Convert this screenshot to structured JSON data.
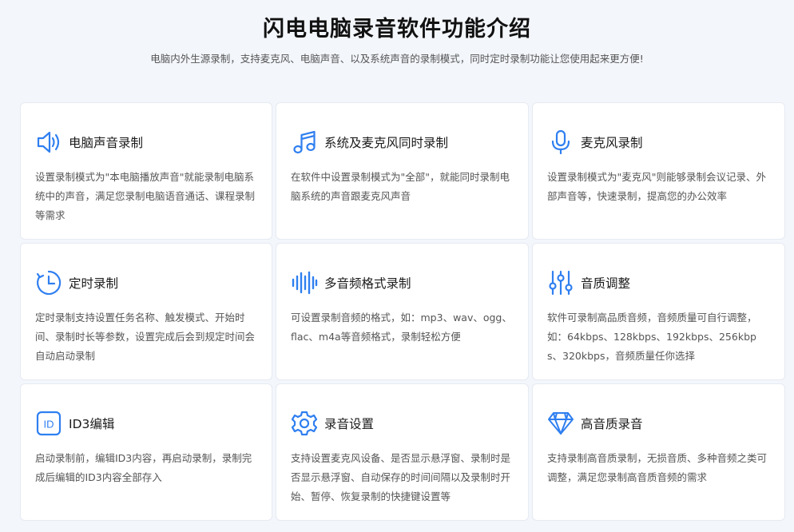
{
  "header": {
    "title": "闪电电脑录音软件功能介绍",
    "subtitle": "电脑内外生源录制，支持麦克风、电脑声音、以及系统声音的录制模式，同时定时录制功能让您使用起来更方便!"
  },
  "accent_color": "#2f7ff0",
  "features": [
    {
      "icon": "speaker-icon",
      "title": "电脑声音录制",
      "desc": "设置录制模式为\"本电脑播放声音\"就能录制电脑系统中的声音，满足您录制电脑语音通话、课程录制等需求"
    },
    {
      "icon": "music-note-icon",
      "title": "系统及麦克风同时录制",
      "desc": "在软件中设置录制模式为\"全部\"，就能同时录制电脑系统的声音跟麦克风声音"
    },
    {
      "icon": "microphone-icon",
      "title": "麦克风录制",
      "desc": "设置录制模式为\"麦克风\"则能够录制会议记录、外部声音等，快速录制，提高您的办公效率"
    },
    {
      "icon": "timer-icon",
      "title": "定时录制",
      "desc": "定时录制支持设置任务名称、触发模式、开始时间、录制时长等参数，设置完成后会到规定时间会自动启动录制"
    },
    {
      "icon": "waveform-icon",
      "title": "多音频格式录制",
      "desc": "可设置录制音频的格式，如：mp3、wav、ogg、flac、m4a等音频格式，录制轻松方便"
    },
    {
      "icon": "equalizer-icon",
      "title": "音质调整",
      "desc": "软件可录制高品质音频，音频质量可自行调整，如：64kbps、128kbps、192kbps、256kbps、320kbps，音频质量任你选择"
    },
    {
      "icon": "id3-icon",
      "icon_text": "ID",
      "title": "ID3编辑",
      "desc": "启动录制前，编辑ID3内容，再启动录制，录制完成后编辑的ID3内容全部存入"
    },
    {
      "icon": "gear-icon",
      "title": "录音设置",
      "desc": "支持设置麦克风设备、是否显示悬浮窗、录制时是否显示悬浮窗、自动保存的时间间隔以及录制时开始、暂停、恢复录制的快捷键设置等"
    },
    {
      "icon": "diamond-icon",
      "title": "高音质录音",
      "desc": "支持录制高音质录制，无损音质、多种音频之类可调整，满足您录制高音质音频的需求"
    }
  ]
}
